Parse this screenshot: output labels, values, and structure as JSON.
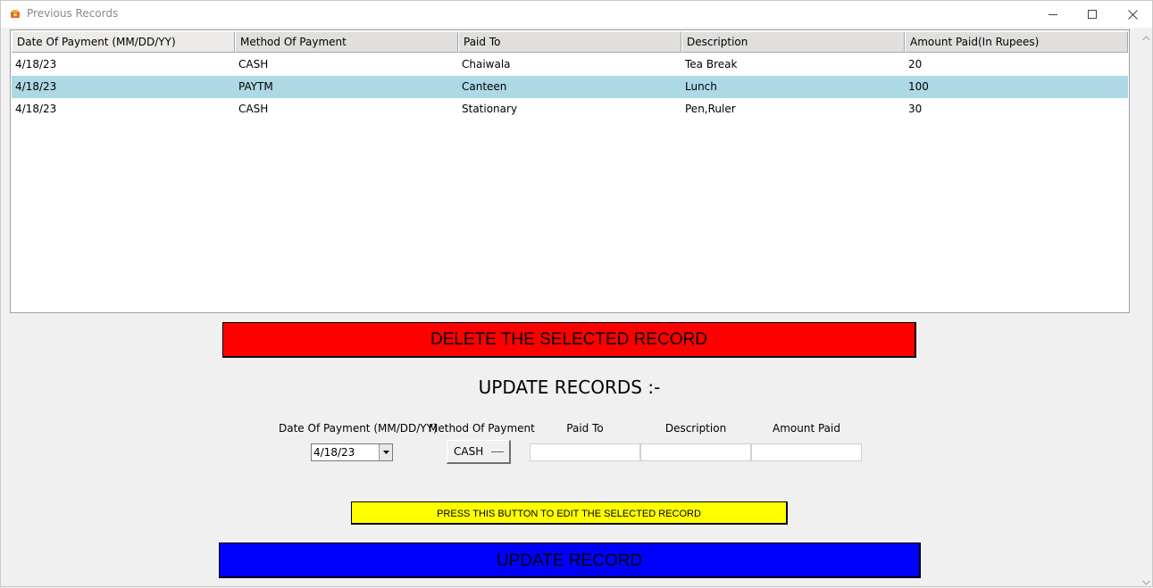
{
  "window": {
    "title": "Previous Records"
  },
  "table": {
    "columns": [
      "Date Of Payment (MM/DD/YY)",
      "Method Of Payment",
      "Paid To",
      "Description",
      "Amount Paid(In Rupees)"
    ],
    "rows": [
      [
        "4/18/23",
        "CASH",
        "Chaiwala",
        "Tea Break",
        "20"
      ],
      [
        "4/18/23",
        "PAYTM",
        "Canteen",
        "Lunch",
        "100"
      ],
      [
        "4/18/23",
        "CASH",
        "Stationary",
        "Pen,Ruler",
        "30"
      ]
    ],
    "selected_row": 1
  },
  "buttons": {
    "delete_label": "DELETE THE SELECTED RECORD",
    "edit_label": "PRESS THIS BUTTON TO EDIT THE SELECTED RECORD",
    "update_label": "UPDATE RECORD"
  },
  "update_section": {
    "title": "UPDATE RECORDS :-",
    "labels": {
      "date": "Date Of Payment (MM/DD/YY)",
      "method": "Method Of Payment",
      "paid_to": "Paid To",
      "description": "Description",
      "amount": "Amount Paid"
    },
    "date_value": "4/18/23",
    "method_value": "CASH",
    "paid_to_value": "",
    "description_value": "",
    "amount_value": ""
  },
  "colors": {
    "delete": "#ff0000",
    "edit": "#ffff00",
    "update": "#0000ff",
    "selection": "#add8e6"
  },
  "icons": {
    "app": "app-icon",
    "minimize": "minimize-icon",
    "maximize": "maximize-icon",
    "close": "close-icon",
    "dropdown": "chevron-down-icon"
  }
}
